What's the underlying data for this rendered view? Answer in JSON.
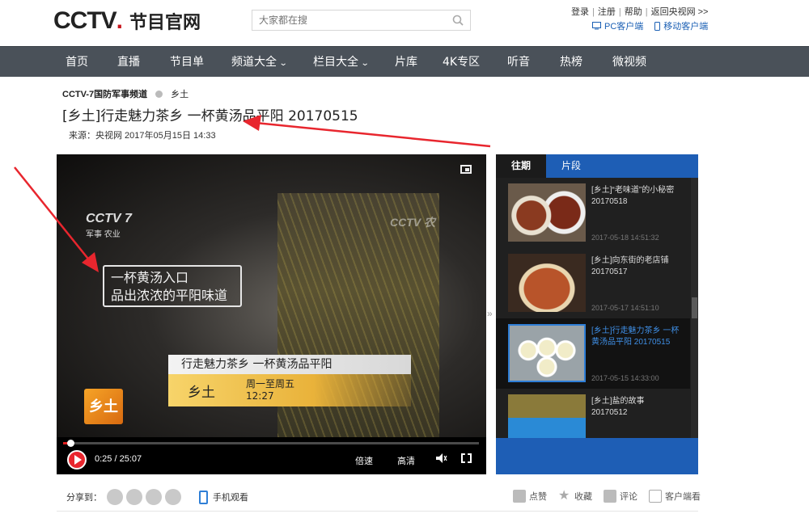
{
  "header": {
    "logo_text": "CCTV",
    "logo_dot": ".",
    "logo_sub": "节目官网",
    "search_placeholder": "大家都在搜",
    "links": [
      "登录",
      "注册",
      "帮助",
      "返回央视网 >>"
    ],
    "clients": [
      "PC客户端",
      "移动客户端"
    ]
  },
  "nav": {
    "items": [
      {
        "label": "首页",
        "dropdown": false
      },
      {
        "label": "直播",
        "dropdown": false
      },
      {
        "label": "节目单",
        "dropdown": false
      },
      {
        "label": "频道大全",
        "dropdown": true
      },
      {
        "label": "栏目大全",
        "dropdown": true
      },
      {
        "label": "片库",
        "dropdown": false
      },
      {
        "label": "4K专区",
        "dropdown": false
      },
      {
        "label": "听音",
        "dropdown": false
      },
      {
        "label": "热榜",
        "dropdown": false
      },
      {
        "label": "微视频",
        "dropdown": false
      }
    ]
  },
  "video_info": {
    "channel": "CCTV-7国防军事频道",
    "column": "乡土",
    "title": "[乡土]行走魅力茶乡 一杯黄汤品平阳 20170515",
    "source": "来源：央视网 2017年05月15日 14:33"
  },
  "player": {
    "tv_logo": "CCTV 7",
    "tv_logo_sub": "军事 农业",
    "tv_logo2": "CCTV 农",
    "caption_lines": [
      "一杯黄汤入口",
      "品出浓浓的平阳味道"
    ],
    "lower_third_title": "行走魅力茶乡  一杯黄汤品平阳",
    "lower_third_name": "乡土",
    "lower_third_schedule": [
      "周一至周五",
      "12:27"
    ],
    "badge": "乡土",
    "time": "0:25 / 25:07",
    "progress": 0.0166,
    "speed_label": "倍速",
    "quality_label": "高清"
  },
  "sidebar": {
    "tabs": [
      {
        "label": "往期",
        "active": true
      },
      {
        "label": "片段",
        "active": false
      }
    ],
    "items": [
      {
        "title": "[乡土]“老味道”的小秘密 20170518",
        "time": "2017-05-18 14:51:32",
        "active": false
      },
      {
        "title": "[乡土]向东街的老店铺 20170517",
        "time": "2017-05-17 14:51:10",
        "active": false
      },
      {
        "title": "[乡土]行走魅力茶乡 一杯黄汤品平阳 20170515",
        "time": "2017-05-15 14:33:00",
        "active": true
      },
      {
        "title": "[乡土]盐的故事 20170512",
        "time": "",
        "active": false
      }
    ]
  },
  "share_bar": {
    "share_label": "分享到：",
    "mobile_label": "手机观看",
    "actions": [
      "点赞",
      "收藏",
      "评论",
      "客户端看"
    ]
  },
  "colors": {
    "brand_red": "#c8161d",
    "nav_bg": "#4a5159",
    "sidebar_blue": "#1e5eb5",
    "annotation_red": "#e8262e"
  }
}
